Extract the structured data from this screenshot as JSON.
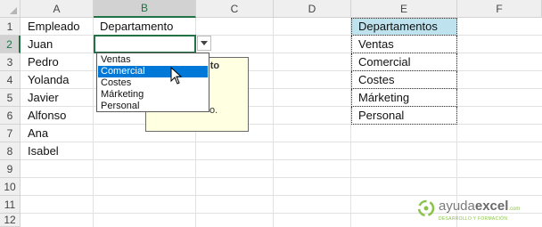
{
  "columns": [
    "A",
    "B",
    "C",
    "D",
    "E",
    "F"
  ],
  "rows": [
    "1",
    "2",
    "3",
    "4",
    "5",
    "6",
    "7",
    "8",
    "9",
    "10",
    "11",
    "12"
  ],
  "sheet": {
    "a1": "Empleado",
    "b1": "Departamento",
    "employees": [
      "Juan",
      "Pedro",
      "Yolanda",
      "Javier",
      "Alfonso",
      "Ana",
      "Isabel"
    ]
  },
  "departments_table": {
    "header": "Departamentos",
    "items": [
      "Ventas",
      "Comercial",
      "Costes",
      "Márketing",
      "Personal"
    ]
  },
  "dropdown": {
    "options": [
      "Ventas",
      "Comercial",
      "Costes",
      "Márketing",
      "Personal"
    ],
    "highlighted": "Comercial"
  },
  "tooltip": {
    "title_fragment": "nto",
    "text_fragment": "o."
  },
  "watermark": {
    "brand_prefix": "ayuda",
    "brand_suffix": "excel",
    "domain": ".com",
    "tagline": "DESARROLLO Y FORMACIÓN"
  },
  "colors": {
    "selected_header": "#217346",
    "list_highlight": "#0078d7",
    "table_header_fill": "#bfe3ee"
  }
}
